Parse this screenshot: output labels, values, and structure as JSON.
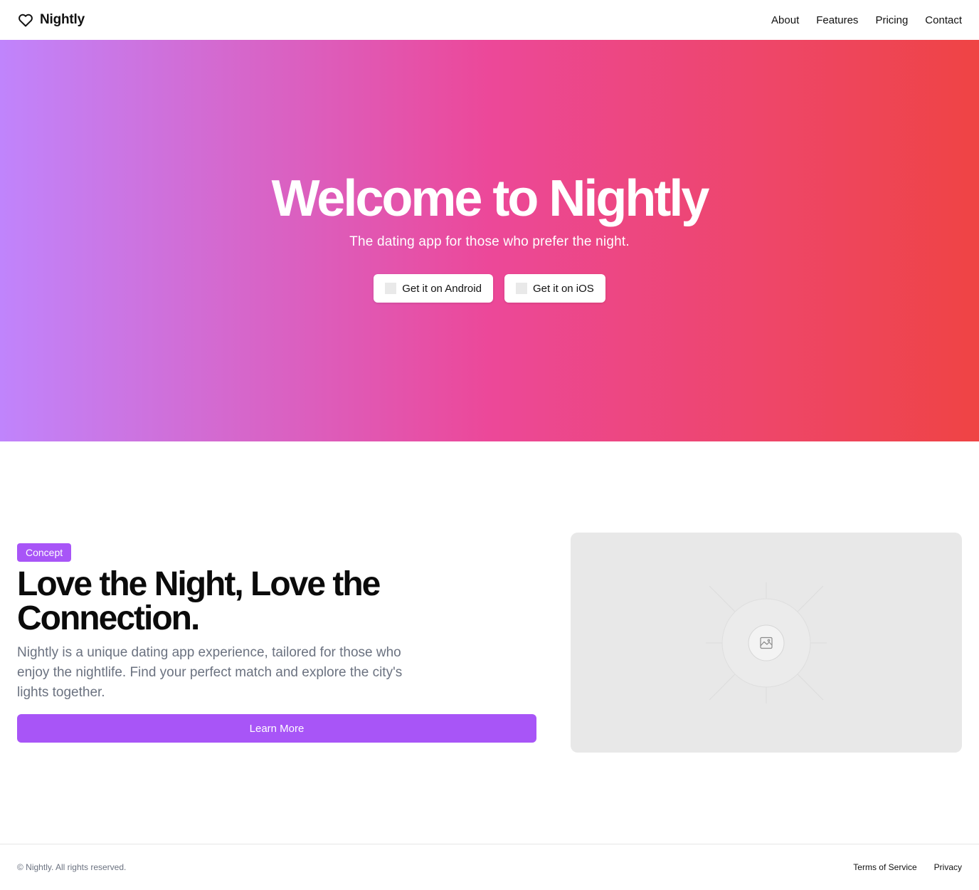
{
  "header": {
    "brand": "Nightly",
    "brand_icon": "heart-icon",
    "nav": [
      "About",
      "Features",
      "Pricing",
      "Contact"
    ]
  },
  "hero": {
    "title": "Welcome to Nightly",
    "subtitle": "The dating app for those who prefer the night.",
    "android_label": "Get it on Android",
    "ios_label": "Get it on iOS",
    "gradient": [
      "#c084fc",
      "#ec4899",
      "#ef4444"
    ]
  },
  "concept": {
    "badge": "Concept",
    "title": "Love the Night, Love the Connection.",
    "description": "Nightly is a unique dating app experience, tailored for those who enjoy the nightlife. Find your perfect match and explore the city's lights together.",
    "button": "Learn More",
    "image_icon": "image-placeholder-icon",
    "accent": "#a855f7"
  },
  "footer": {
    "copyright": "© Nightly. All rights reserved.",
    "links": [
      "Terms of Service",
      "Privacy"
    ]
  }
}
